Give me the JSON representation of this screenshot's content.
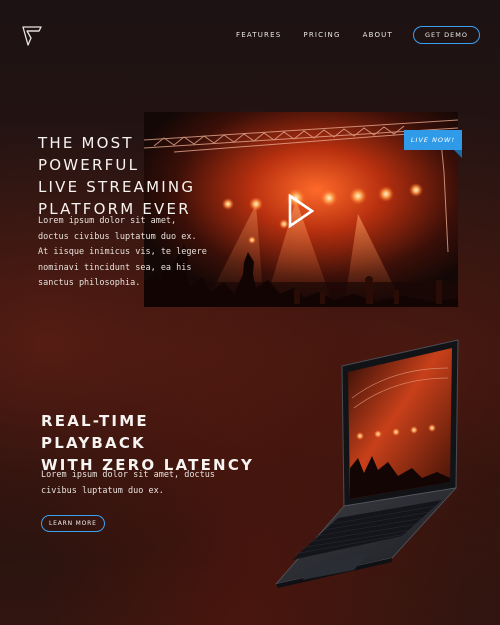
{
  "nav": {
    "links": [
      "FEATURES",
      "PRICING",
      "ABOUT"
    ],
    "cta": "GET DEMO"
  },
  "hero": {
    "title": "THE MOST POWERFUL\nLIVE STREAMING\nPLATFORM EVER",
    "body": "Lorem ipsum dolor sit amet, doctus civibus luptatum duo ex. At iisque inimicus vis, te legere nominavi tincidunt sea, ea his sanctus philosophia.",
    "badge": "LIVE NOW!"
  },
  "feature": {
    "title": "REAL-TIME PLAYBACK\nWITH ZERO LATENCY",
    "body": "Lorem ipsum dolor sit amet, doctus civibus luptatum duo ex.",
    "button": "LEARN MORE"
  },
  "colors": {
    "accent": "#2f9be8",
    "background": "#23110e",
    "text": "#f7f3f0"
  },
  "icons": {
    "logo": "logo-icon",
    "play": "play-icon"
  }
}
